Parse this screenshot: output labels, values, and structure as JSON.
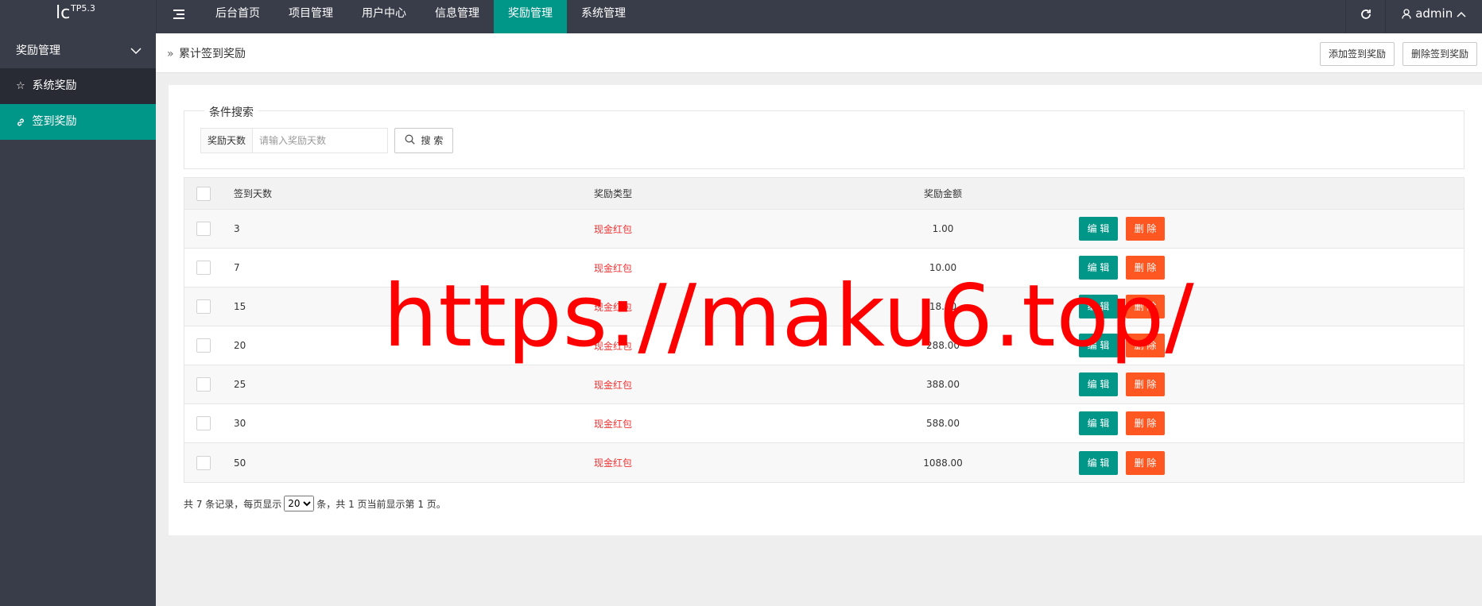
{
  "logo": {
    "text": "lc",
    "version": "TP5.3"
  },
  "topnav": {
    "toggle_icon": "menu-toggle-icon",
    "items": [
      "后台首页",
      "项目管理",
      "用户中心",
      "信息管理",
      "奖励管理",
      "系统管理"
    ],
    "active": "奖励管理"
  },
  "topright": {
    "refresh_icon": "refresh-icon",
    "user": "admin"
  },
  "sidebar": {
    "group": "奖励管理",
    "items": [
      {
        "label": "系统奖励",
        "icon": "star-icon"
      },
      {
        "label": "签到奖励",
        "icon": "link-icon",
        "active": true
      }
    ]
  },
  "breadcrumb": {
    "current": "累计签到奖励"
  },
  "actions": {
    "add": "添加签到奖励",
    "delete": "删除签到奖励"
  },
  "search": {
    "legend": "条件搜索",
    "label": "奖励天数",
    "placeholder": "请输入奖励天数",
    "button": "搜 索"
  },
  "table": {
    "headers": {
      "days": "签到天数",
      "type": "奖励类型",
      "amount": "奖励金额"
    },
    "edit_label": "编 辑",
    "delete_label": "删 除",
    "rows": [
      {
        "days": "3",
        "type": "现金红包",
        "amount": "1.00"
      },
      {
        "days": "7",
        "type": "现金红包",
        "amount": "10.00"
      },
      {
        "days": "15",
        "type": "现金红包",
        "amount": "18.00"
      },
      {
        "days": "20",
        "type": "现金红包",
        "amount": "288.00"
      },
      {
        "days": "25",
        "type": "现金红包",
        "amount": "388.00"
      },
      {
        "days": "30",
        "type": "现金红包",
        "amount": "588.00"
      },
      {
        "days": "50",
        "type": "现金红包",
        "amount": "1088.00"
      }
    ]
  },
  "pager": {
    "prefix": "共 7 条记录，每页显示",
    "page_size": "20",
    "suffix": "条，共 1 页当前显示第 1 页。"
  },
  "watermark": "https://maku6.top/",
  "colors": {
    "accent": "#009688",
    "danger": "#ff5722",
    "dark": "#393d49",
    "type_text": "#ee3333"
  }
}
